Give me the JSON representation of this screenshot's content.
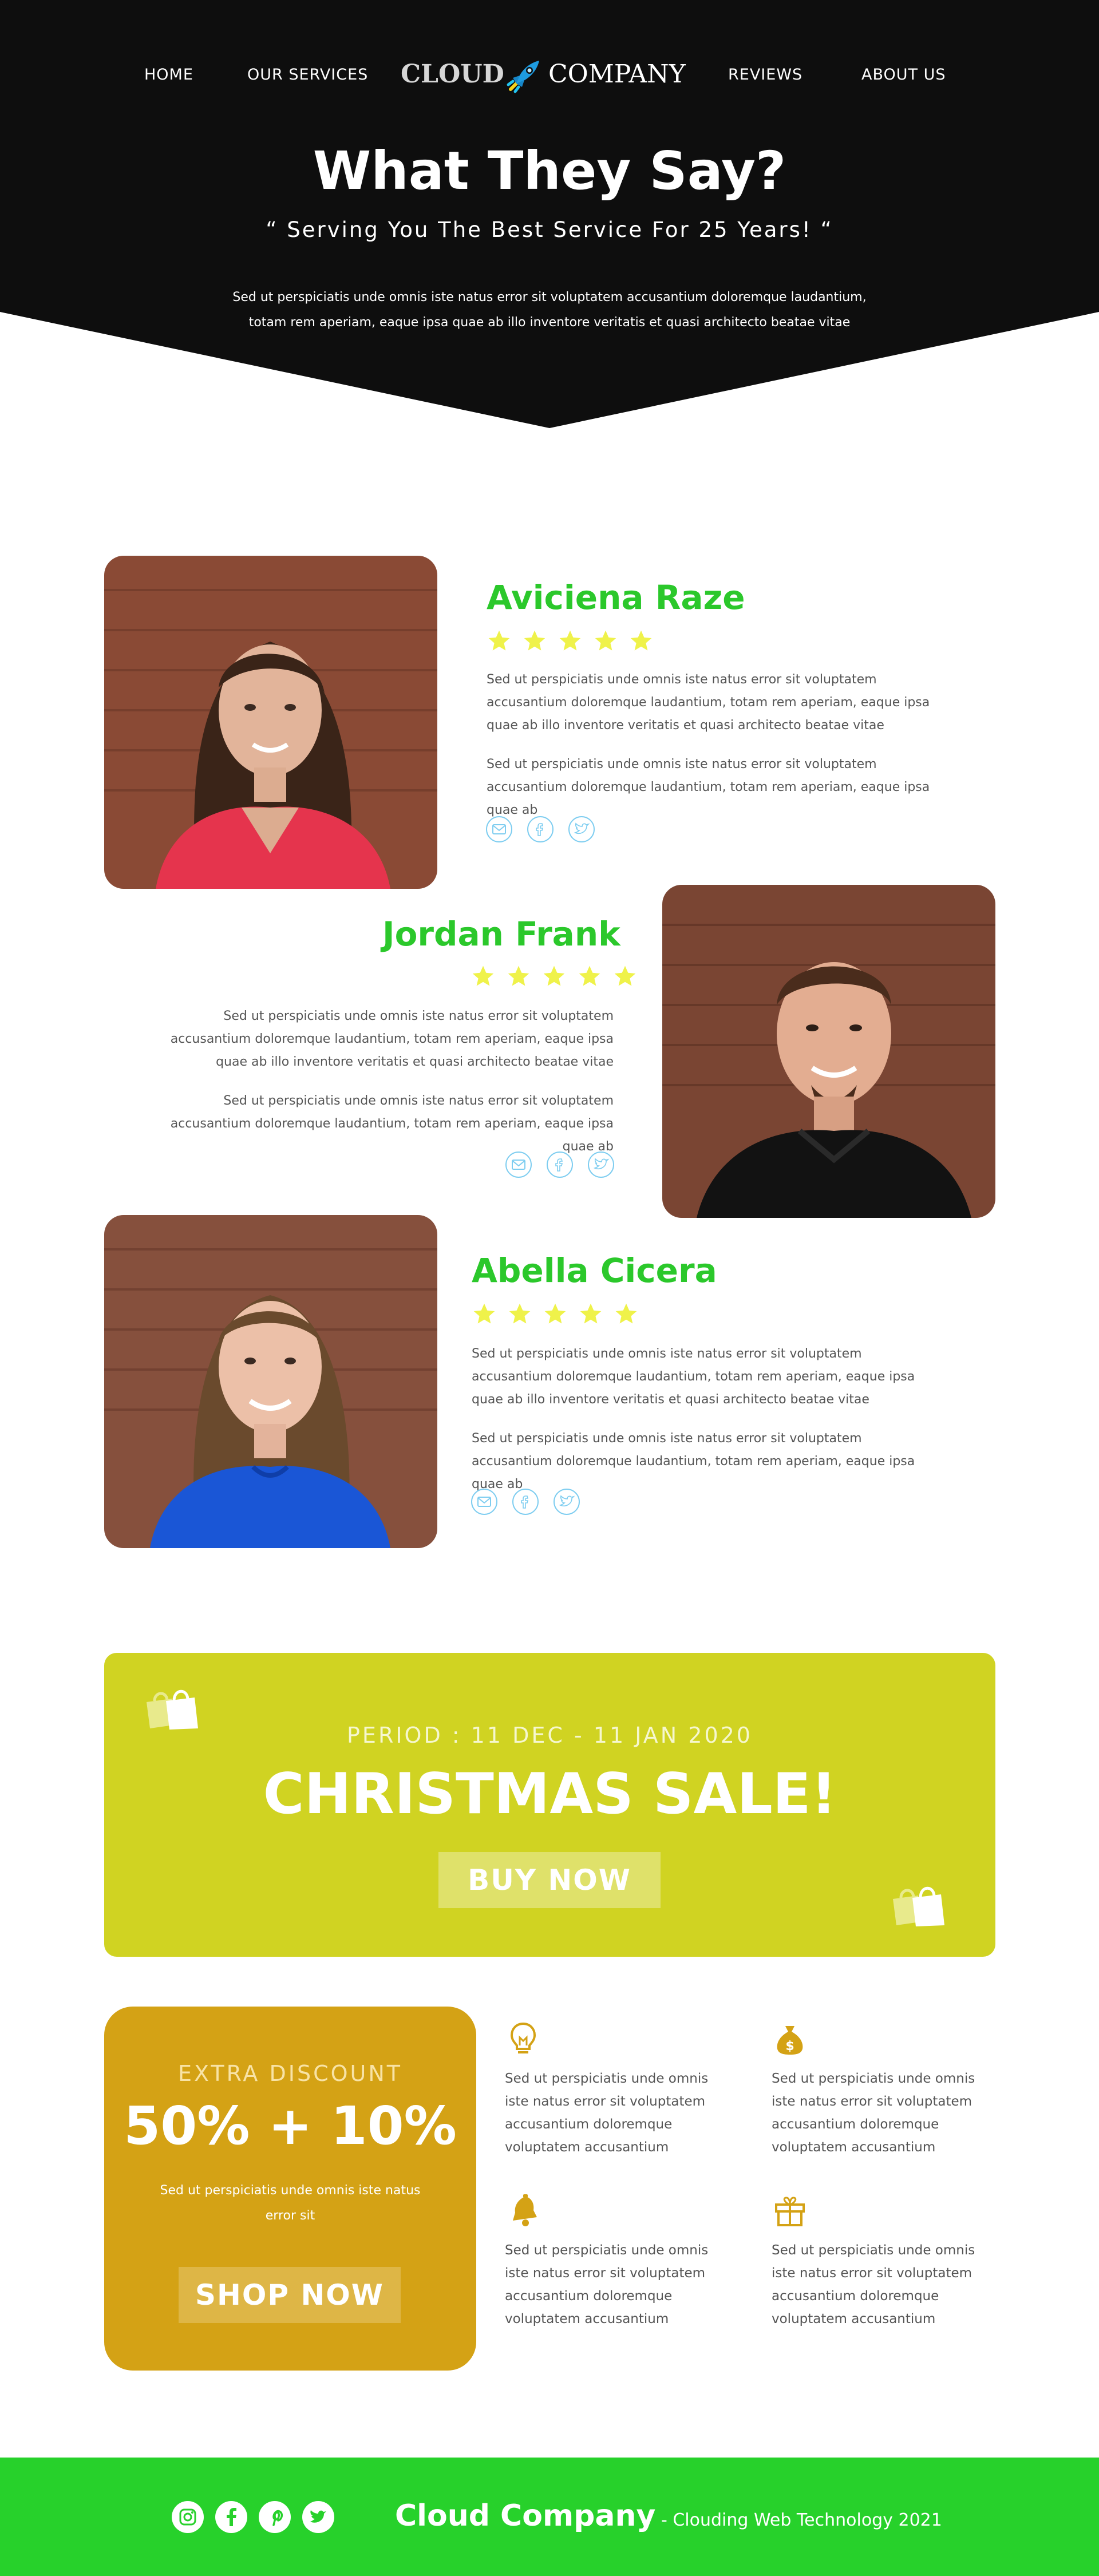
{
  "nav": {
    "items": [
      "HOME",
      "OUR SERVICES",
      "REVIEWS",
      "ABOUT US"
    ],
    "logo_left": "CLOUD",
    "logo_right": "COMPANY"
  },
  "hero": {
    "title": "What They Say?",
    "subtitle": "“ Serving You The Best Service For 25 Years! “",
    "text_line1": "Sed ut perspiciatis unde omnis iste natus error sit voluptatem accusantium doloremque laudantium,",
    "text_line2": "totam rem aperiam, eaque ipsa quae ab illo inventore veritatis et quasi architecto beatae vitae"
  },
  "testimonials": [
    {
      "name": "Aviciena Raze",
      "rating": 5,
      "para1": "Sed ut perspiciatis unde omnis iste natus error sit voluptatem accusantium doloremque laudantium, totam rem aperiam, eaque ipsa quae ab illo inventore veritatis et quasi architecto beatae vitae",
      "para2": "Sed ut perspiciatis unde omnis iste natus error sit voluptatem accusantium doloremque laudantium, totam rem aperiam, eaque ipsa quae ab"
    },
    {
      "name": "Jordan Frank",
      "rating": 5,
      "para1": "Sed ut perspiciatis unde omnis iste natus error sit voluptatem accusantium doloremque laudantium, totam rem aperiam, eaque ipsa quae ab illo inventore veritatis et quasi architecto beatae vitae",
      "para2": "Sed ut perspiciatis unde omnis iste natus error sit voluptatem accusantium doloremque laudantium, totam rem aperiam, eaque ipsa quae ab"
    },
    {
      "name": "Abella Cicera",
      "rating": 5,
      "para1": "Sed ut perspiciatis unde omnis iste natus error sit voluptatem accusantium doloremque laudantium, totam rem aperiam, eaque ipsa quae ab illo inventore veritatis et quasi architecto beatae vitae",
      "para2": "Sed ut perspiciatis unde omnis iste natus error sit voluptatem accusantium doloremque laudantium, totam rem aperiam, eaque ipsa quae ab"
    }
  ],
  "sale": {
    "period": "PERIOD : 11 DEC - 11 JAN 2020",
    "title": "CHRISTMAS SALE!",
    "button": "BUY NOW"
  },
  "discount": {
    "label": "EXTRA DISCOUNT",
    "value": "50% + 10%",
    "text": "Sed ut perspiciatis unde omnis iste natus error sit",
    "button": "SHOP NOW"
  },
  "features": [
    {
      "icon": "lightbulb-icon",
      "text": "Sed ut perspiciatis unde omnis iste natus error sit voluptatem accusantium doloremque voluptatem accusantium"
    },
    {
      "icon": "money-bag-icon",
      "text": "Sed ut perspiciatis unde omnis iste natus error sit voluptatem accusantium doloremque voluptatem accusantium"
    },
    {
      "icon": "bell-icon",
      "text": "Sed ut perspiciatis unde omnis iste natus error sit voluptatem accusantium doloremque voluptatem accusantium"
    },
    {
      "icon": "gift-icon",
      "text": "Sed ut perspiciatis unde omnis iste natus error sit voluptatem accusantium doloremque voluptatem accusantium"
    }
  ],
  "footer": {
    "brand": "Cloud Company",
    "tagline": "- Clouding Web Technology 2021"
  },
  "colors": {
    "hero_bg": "#0e0e0e",
    "name_green": "#2bc82b",
    "star_yellow": "#eff24a",
    "social_blue": "#7ecdf0",
    "sale_bg": "#d0d322",
    "discount_bg": "#d4a215",
    "footer_bg": "#27d12b"
  }
}
